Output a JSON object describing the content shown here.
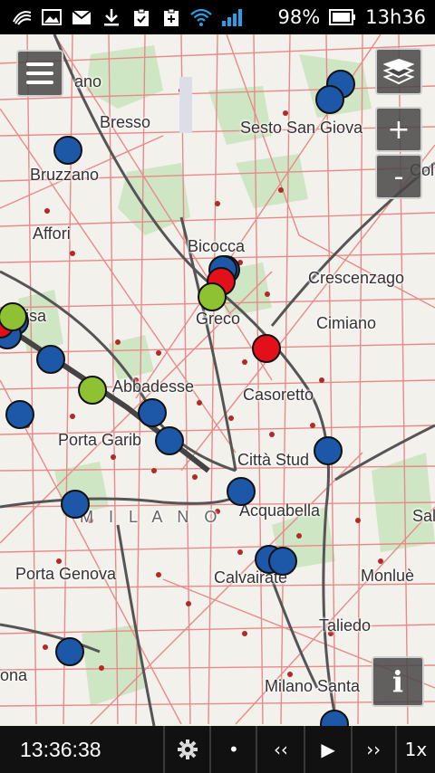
{
  "status_bar": {
    "icons": [
      "signal-swirl-icon",
      "image-icon",
      "mail-icon",
      "download-icon",
      "clipboard-check-icon",
      "clipboard-plus-icon",
      "wifi-icon",
      "cell-signal-icon"
    ],
    "battery_percent": "98%",
    "battery_icon": "battery-icon",
    "clock": "13h36"
  },
  "map": {
    "places": [
      {
        "key": "niguarda",
        "label": "ano"
      },
      {
        "key": "bresso",
        "label": "Bresso"
      },
      {
        "key": "sesto",
        "label": "Sesto San Giova"
      },
      {
        "key": "bruzzano",
        "label": "Bruzzano"
      },
      {
        "key": "affori",
        "label": "Affori"
      },
      {
        "key": "bicocca",
        "label": "Bicocca"
      },
      {
        "key": "crescenzago",
        "label": "Crescenzago"
      },
      {
        "key": "greco",
        "label": "Greco"
      },
      {
        "key": "cimiano",
        "label": "Cimiano"
      },
      {
        "key": "bovisa",
        "label": "isa"
      },
      {
        "key": "abbadesse",
        "label": "Abbadesse"
      },
      {
        "key": "casoretto",
        "label": "Casoretto"
      },
      {
        "key": "garibaldi",
        "label": "Porta Garib"
      },
      {
        "key": "cittastudi",
        "label": "Città Stud"
      },
      {
        "key": "milano",
        "label": "M I L A N O"
      },
      {
        "key": "acquabella",
        "label": "Acquabella"
      },
      {
        "key": "sal",
        "label": "Sal"
      },
      {
        "key": "genova",
        "label": "Porta Genova"
      },
      {
        "key": "calvairate",
        "label": "Calvairate"
      },
      {
        "key": "monlue",
        "label": "Monluè"
      },
      {
        "key": "taliedo",
        "label": "Taliedo"
      },
      {
        "key": "ona",
        "label": "ona"
      },
      {
        "key": "santagiulia",
        "label": "Milano Santa"
      },
      {
        "key": "col",
        "label": "Col"
      }
    ],
    "markers": [
      {
        "color": "blue"
      },
      {
        "color": "blue"
      },
      {
        "color": "blue"
      },
      {
        "color": "blue"
      },
      {
        "color": "blue"
      },
      {
        "color": "blue"
      },
      {
        "color": "blue"
      },
      {
        "color": "blue"
      },
      {
        "color": "blue"
      },
      {
        "color": "blue"
      },
      {
        "color": "blue"
      },
      {
        "color": "blue"
      },
      {
        "color": "blue"
      },
      {
        "color": "blue"
      },
      {
        "color": "blue"
      },
      {
        "color": "blue"
      },
      {
        "color": "blue"
      },
      {
        "color": "blue"
      },
      {
        "color": "red"
      },
      {
        "color": "red"
      },
      {
        "color": "red"
      },
      {
        "color": "green"
      },
      {
        "color": "green"
      },
      {
        "color": "green"
      }
    ],
    "marker_colors": {
      "blue": "#1c57a8",
      "red": "#e3101a",
      "green": "#8fc232"
    }
  },
  "controls": {
    "menu_icon": "hamburger-menu-icon",
    "layers_icon": "layers-icon",
    "zoom_in_label": "+",
    "zoom_out_label": "-",
    "info_label": "i"
  },
  "player": {
    "time": "13:36:38",
    "settings_icon": "gear-icon",
    "record_label": "•",
    "rewind_label": "‹‹",
    "play_label": "▶",
    "forward_label": "››",
    "speed_label": "1x"
  }
}
